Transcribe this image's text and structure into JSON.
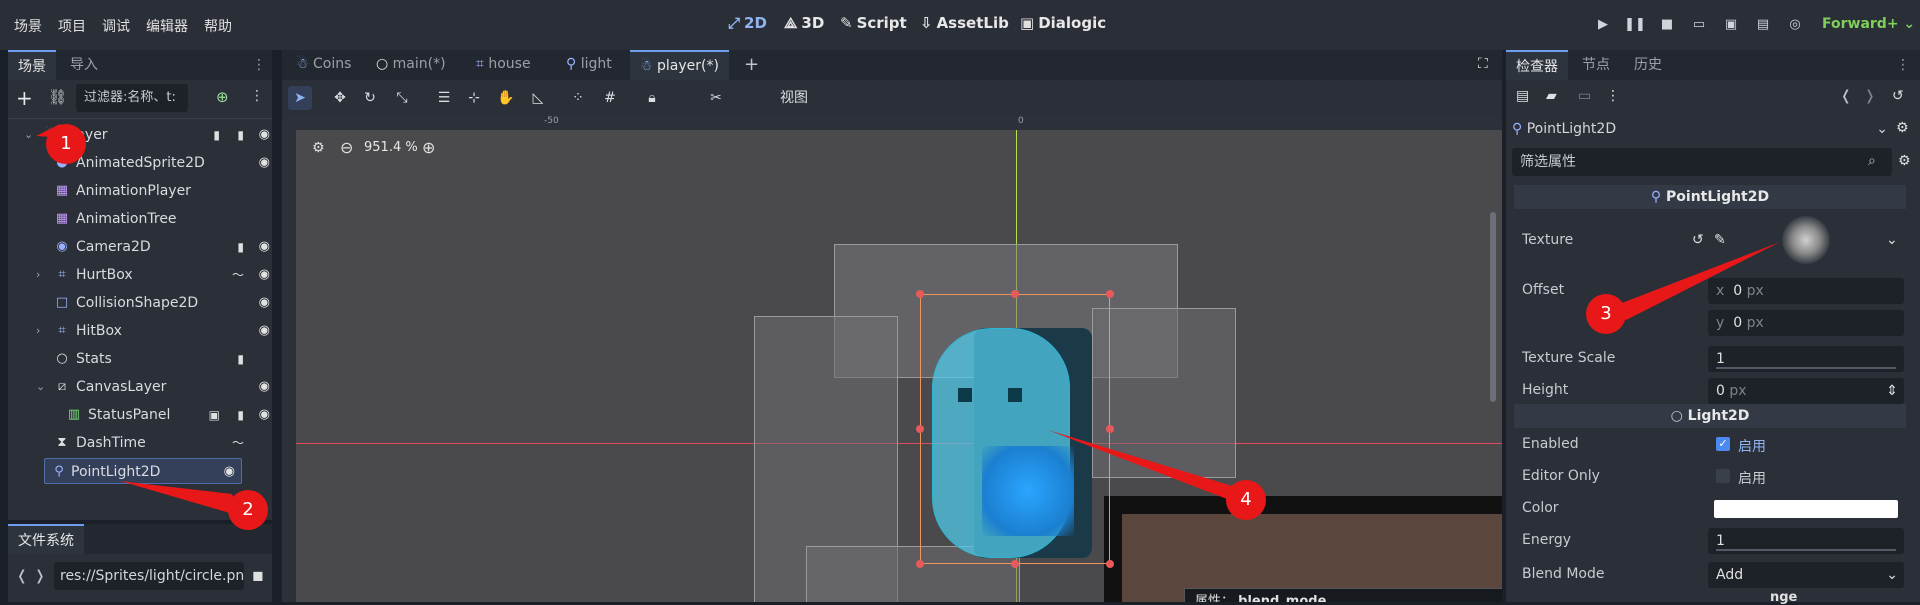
{
  "menu": [
    "场景",
    "项目",
    "调试",
    "编辑器",
    "帮助"
  ],
  "modes": [
    {
      "icon": "⤢",
      "label": "2D",
      "active": true
    },
    {
      "icon": "⟁",
      "label": "3D"
    },
    {
      "icon": "✎",
      "label": "Script"
    },
    {
      "icon": "⇩",
      "label": "AssetLib"
    },
    {
      "icon": "▣",
      "label": "Dialogic"
    }
  ],
  "renderer": "Forward+",
  "left_tabs": [
    "场景",
    "导入"
  ],
  "filter_placeholder": "过滤器:名称、t:",
  "tree": [
    {
      "label": "Player",
      "icon": "player-node-icon",
      "glyph": "☃",
      "color": "#8fb4f0",
      "depth": 0,
      "expand": "v",
      "extras": [
        "script",
        "script"
      ]
    },
    {
      "label": "AnimatedSprite2D",
      "icon": "animated-sprite-icon",
      "glyph": "◕",
      "color": "#9bb0ff",
      "depth": 1
    },
    {
      "label": "AnimationPlayer",
      "icon": "animation-player-icon",
      "glyph": "▦",
      "color": "#c69bff",
      "depth": 1,
      "noeye": true
    },
    {
      "label": "AnimationTree",
      "icon": "animation-tree-icon",
      "glyph": "▦",
      "color": "#c69bff",
      "depth": 1,
      "noeye": true
    },
    {
      "label": "Camera2D",
      "icon": "camera-icon",
      "glyph": "◉",
      "color": "#9bb0ff",
      "depth": 1,
      "extras": [
        "script"
      ]
    },
    {
      "label": "HurtBox",
      "icon": "area-icon",
      "glyph": "⌗",
      "color": "#9bb0ff",
      "depth": 1,
      "expand": ">",
      "extras": [
        "signal"
      ]
    },
    {
      "label": "CollisionShape2D",
      "icon": "collision-icon",
      "glyph": "□",
      "color": "#9bb0ff",
      "depth": 1
    },
    {
      "label": "HitBox",
      "icon": "area-icon",
      "glyph": "⌗",
      "color": "#9bb0ff",
      "depth": 1,
      "expand": ">"
    },
    {
      "label": "Stats",
      "icon": "node-icon",
      "glyph": "○",
      "color": "#e0e0e0",
      "depth": 1,
      "noeye": true,
      "extras": [
        "script"
      ]
    },
    {
      "label": "CanvasLayer",
      "icon": "canvas-layer-icon",
      "glyph": "⧄",
      "color": "#e0e0e0",
      "depth": 1,
      "expand": "v"
    },
    {
      "label": "StatusPanel",
      "icon": "control-icon",
      "glyph": "▥",
      "color": "#7fe07f",
      "depth": 2,
      "extras": [
        "scene",
        "script"
      ]
    },
    {
      "label": "DashTime",
      "icon": "timer-icon",
      "glyph": "⧗",
      "color": "#e0e0e0",
      "depth": 1,
      "noeye": true,
      "extras": [
        "signal"
      ]
    },
    {
      "label": "PointLight2D",
      "icon": "light-icon",
      "glyph": "⚲",
      "color": "#9bb0ff",
      "depth": 1,
      "selected": true
    }
  ],
  "fs_tab": "文件系统",
  "fs_path": "res://Sprites/light/circle.pn",
  "editor_tabs": [
    {
      "label": "Coins",
      "glyph": "☃",
      "color": "#8fb4f0"
    },
    {
      "label": "main(*)",
      "glyph": "○",
      "color": "#e0e0e0"
    },
    {
      "label": "house",
      "glyph": "⌗",
      "color": "#9bb0ff"
    },
    {
      "label": "light",
      "glyph": "⚲",
      "color": "#9bb0ff"
    },
    {
      "label": "player(*)",
      "glyph": "☃",
      "color": "#8fb4f0",
      "active": true
    }
  ],
  "view_menu": "视图",
  "zoom": "951.4 %",
  "ruler": [
    "-50",
    "0"
  ],
  "right_tabs": [
    "检查器",
    "节点",
    "历史"
  ],
  "node_selector": "PointLight2D",
  "filter_props": "筛选属性",
  "sections": [
    "PointLight2D",
    "Light2D"
  ],
  "props": {
    "texture": "Texture",
    "offset": "Offset",
    "offset_x": "0",
    "offset_y": "0",
    "px": "px",
    "texture_scale": "Texture Scale",
    "texture_scale_val": "1",
    "height": "Height",
    "height_val": "0",
    "enabled": "Enabled",
    "editor_only": "Editor Only",
    "on_label": "启用",
    "color": "Color",
    "energy": "Energy",
    "energy_val": "1",
    "blend_mode": "Blend Mode",
    "blend_mode_val": "Add",
    "x": "x",
    "y": "y"
  },
  "tooltip": {
    "prefix": "属性：",
    "value": "blend_mode"
  },
  "bottom_text": "nge",
  "callouts": [
    "1",
    "2",
    "3",
    "4"
  ]
}
